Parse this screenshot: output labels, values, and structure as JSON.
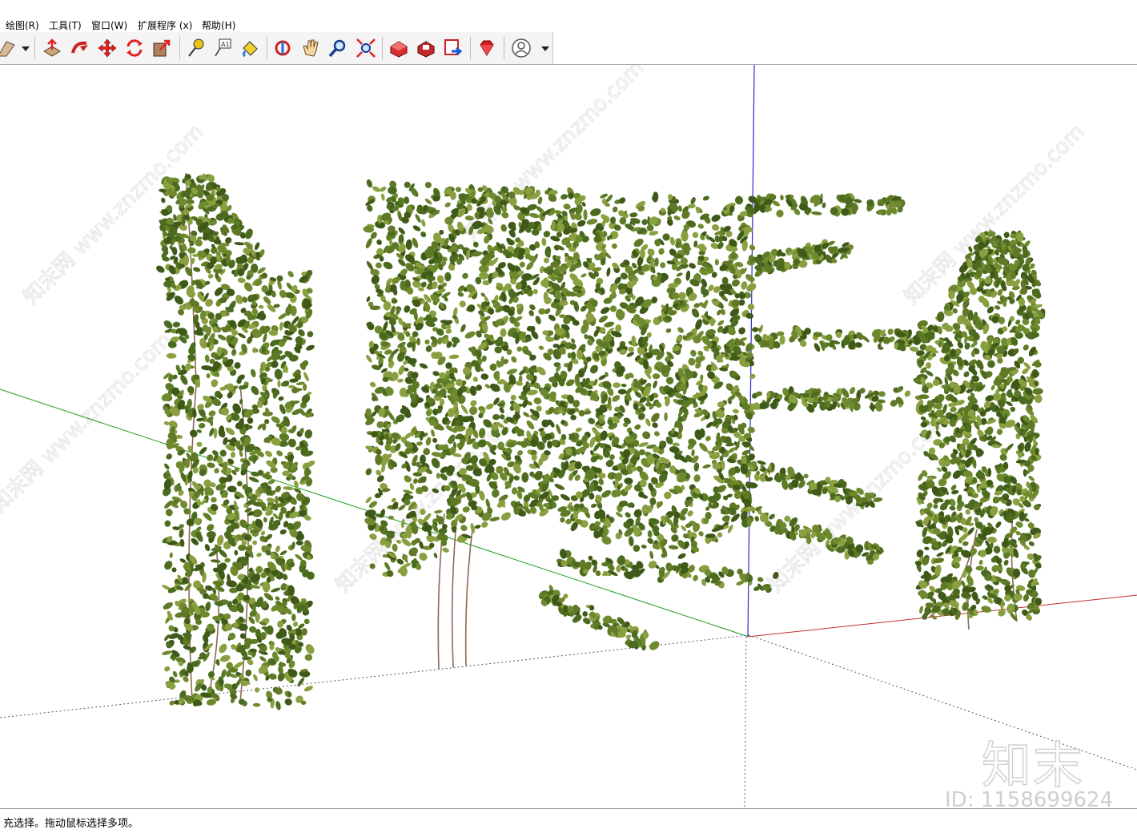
{
  "menu": {
    "items": [
      {
        "label": "绘图(R)"
      },
      {
        "label": "工具(T)"
      },
      {
        "label": "窗口(W)"
      },
      {
        "label": "扩展程序 (x)"
      },
      {
        "label": "帮助(H)"
      }
    ]
  },
  "toolbar": {
    "buttons": [
      {
        "icon": "eraser-icon"
      },
      {
        "icon": "dropdown-arrow-icon"
      },
      {
        "icon": "push-pull-icon"
      },
      {
        "icon": "follow-me-icon"
      },
      {
        "icon": "move-icon"
      },
      {
        "icon": "rotate-icon"
      },
      {
        "icon": "scale-icon"
      },
      {
        "icon": "tape-measure-icon"
      },
      {
        "icon": "text-icon"
      },
      {
        "icon": "paint-bucket-icon"
      },
      {
        "icon": "orbit-icon"
      },
      {
        "icon": "pan-hand-icon"
      },
      {
        "icon": "zoom-icon"
      },
      {
        "icon": "zoom-extents-icon"
      },
      {
        "icon": "3d-warehouse-icon"
      },
      {
        "icon": "extension-warehouse-icon"
      },
      {
        "icon": "send-to-layout-icon"
      },
      {
        "icon": "ruby-console-icon"
      },
      {
        "icon": "user-account-icon"
      },
      {
        "icon": "account-dropdown-icon"
      }
    ]
  },
  "viewport": {
    "watermark_text": "www.znzmo.com",
    "watermark_brand": "知末网",
    "colors": {
      "axis_green": "#1a9e1a",
      "axis_blue": "#2b2bd6",
      "axis_red": "#c23030",
      "foliage_dark": "#3f5a18",
      "foliage_mid": "#5e7a26",
      "foliage_light": "#8aa040",
      "vine_stem": "#8b6a55"
    }
  },
  "status": {
    "text": "充选择。拖动鼠标选择多项。"
  },
  "watermark": {
    "logo": "知末",
    "id": "ID: 1158699624"
  }
}
